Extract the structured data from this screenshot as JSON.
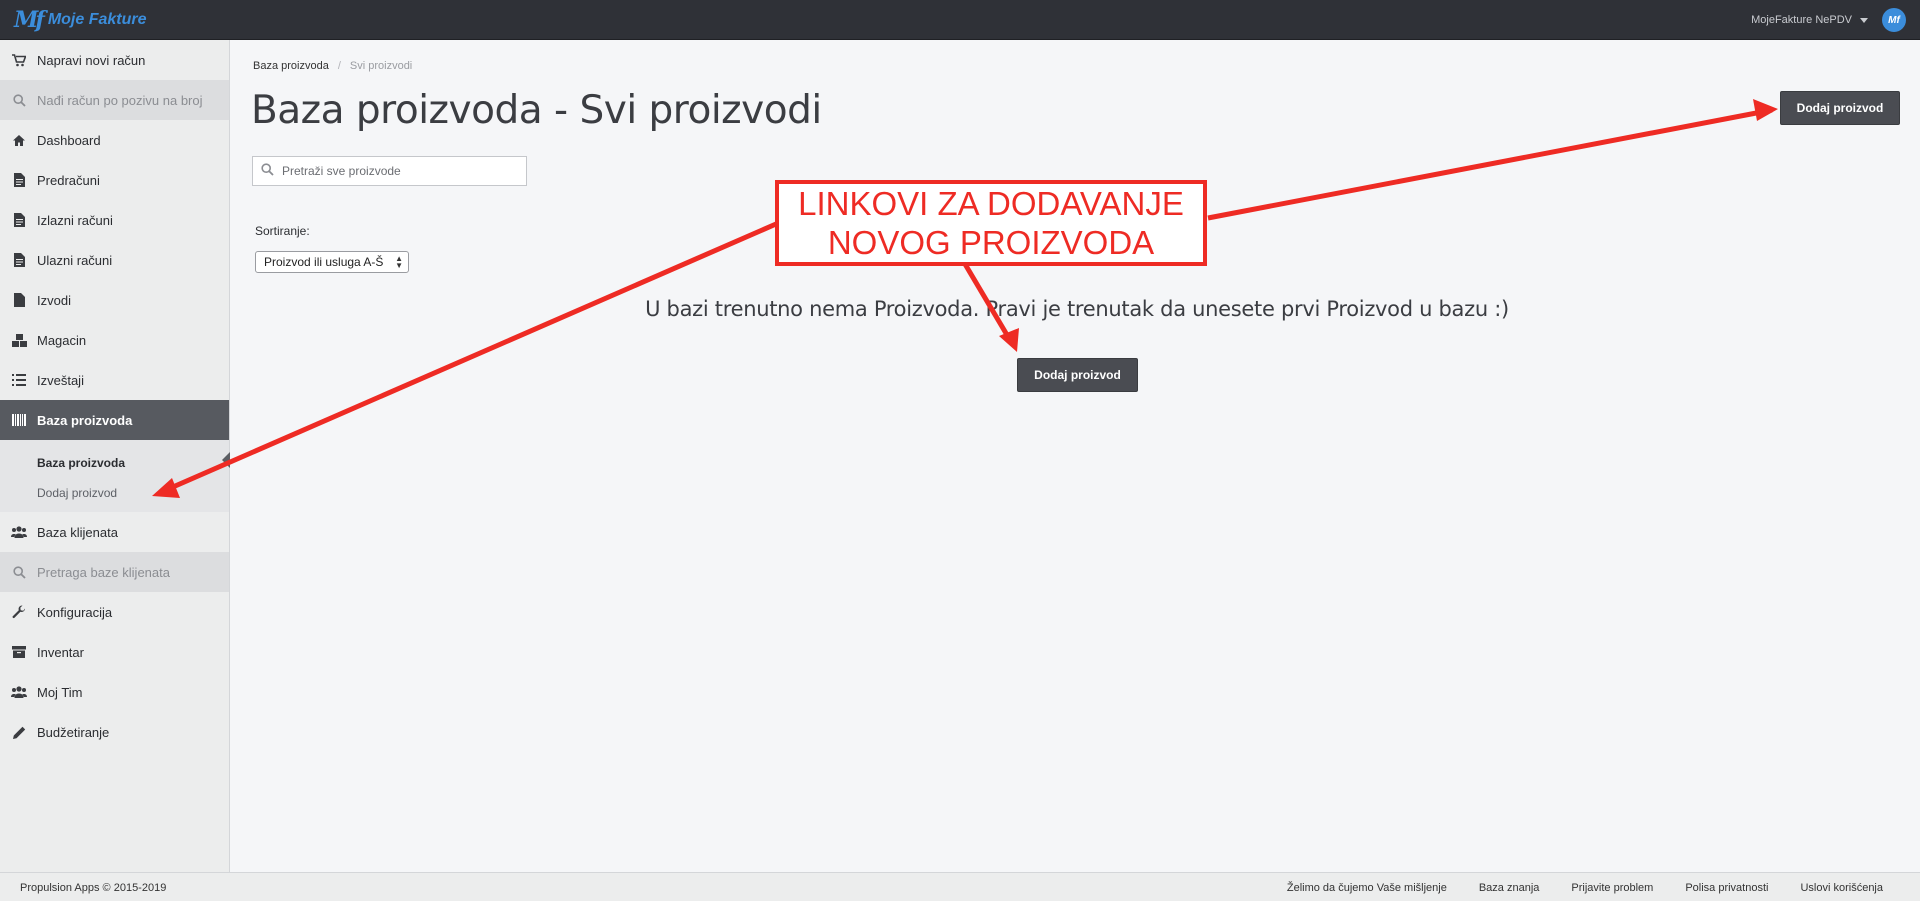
{
  "topbar": {
    "logo_mark": "Mf",
    "logo_text": "Moje Fakture",
    "user_name": "MojeFakture NePDV",
    "avatar_text": "Mf"
  },
  "sidebar": {
    "items": [
      {
        "label": "Napravi novi račun",
        "icon": "cart-icon"
      },
      {
        "label": "Nađi račun po pozivu na broj",
        "icon": "search-icon"
      },
      {
        "label": "Dashboard",
        "icon": "home-icon"
      },
      {
        "label": "Predračuni",
        "icon": "document-icon"
      },
      {
        "label": "Izlazni računi",
        "icon": "document-icon"
      },
      {
        "label": "Ulazni računi",
        "icon": "document-icon"
      },
      {
        "label": "Izvodi",
        "icon": "file-icon"
      },
      {
        "label": "Magacin",
        "icon": "boxes-icon"
      },
      {
        "label": "Izveštaji",
        "icon": "list-icon"
      },
      {
        "label": "Baza proizvoda",
        "icon": "barcode-icon"
      },
      {
        "label": "Baza klijenata",
        "icon": "users-icon"
      },
      {
        "label": "Pretraga baze klijenata",
        "icon": "search-icon"
      },
      {
        "label": "Konfiguracija",
        "icon": "wrench-icon"
      },
      {
        "label": "Inventar",
        "icon": "archive-icon"
      },
      {
        "label": "Moj Tim",
        "icon": "users-icon"
      },
      {
        "label": "Budžetiranje",
        "icon": "pencil-icon"
      }
    ],
    "subitems": [
      {
        "label": "Baza proizvoda"
      },
      {
        "label": "Dodaj proizvod"
      }
    ]
  },
  "breadcrumb": {
    "root": "Baza proizvoda",
    "separator": "/",
    "current": "Svi proizvodi"
  },
  "page": {
    "title": "Baza proizvoda - Svi proizvodi",
    "add_button": "Dodaj proizvod",
    "search_placeholder": "Pretraži sve proizvode",
    "sort_label": "Sortiranje:",
    "sort_value": "Proizvod ili usluga A-Š",
    "empty_message": "U bazi trenutno nema Proizvoda. Pravi je trenutak da unesete prvi Proizvod u bazu :)",
    "empty_add_button": "Dodaj proizvod"
  },
  "annotation": {
    "line1": "LINKOVI ZA DODAVANJE",
    "line2": "NOVOG PROIZVODA",
    "color": "#ee2b24"
  },
  "footer": {
    "copyright": "Propulsion Apps © 2015-2019",
    "links": [
      "Želimo da čujemo Vaše mišljenje",
      "Baza znanja",
      "Prijavite problem",
      "Polisa privatnosti",
      "Uslovi korišćenja"
    ]
  }
}
